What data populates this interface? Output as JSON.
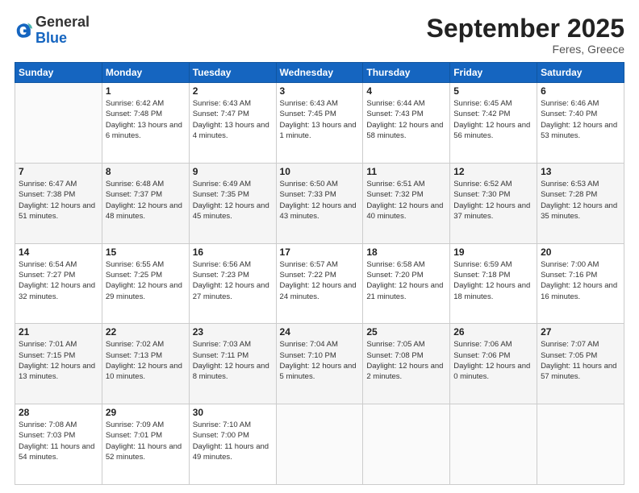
{
  "header": {
    "logo": {
      "general": "General",
      "blue": "Blue"
    },
    "title": "September 2025",
    "location": "Feres, Greece"
  },
  "weekdays": [
    "Sunday",
    "Monday",
    "Tuesday",
    "Wednesday",
    "Thursday",
    "Friday",
    "Saturday"
  ],
  "weeks": [
    [
      {
        "day": "",
        "sunrise": "",
        "sunset": "",
        "daylight": ""
      },
      {
        "day": "1",
        "sunrise": "Sunrise: 6:42 AM",
        "sunset": "Sunset: 7:48 PM",
        "daylight": "Daylight: 13 hours and 6 minutes."
      },
      {
        "day": "2",
        "sunrise": "Sunrise: 6:43 AM",
        "sunset": "Sunset: 7:47 PM",
        "daylight": "Daylight: 13 hours and 4 minutes."
      },
      {
        "day": "3",
        "sunrise": "Sunrise: 6:43 AM",
        "sunset": "Sunset: 7:45 PM",
        "daylight": "Daylight: 13 hours and 1 minute."
      },
      {
        "day": "4",
        "sunrise": "Sunrise: 6:44 AM",
        "sunset": "Sunset: 7:43 PM",
        "daylight": "Daylight: 12 hours and 58 minutes."
      },
      {
        "day": "5",
        "sunrise": "Sunrise: 6:45 AM",
        "sunset": "Sunset: 7:42 PM",
        "daylight": "Daylight: 12 hours and 56 minutes."
      },
      {
        "day": "6",
        "sunrise": "Sunrise: 6:46 AM",
        "sunset": "Sunset: 7:40 PM",
        "daylight": "Daylight: 12 hours and 53 minutes."
      }
    ],
    [
      {
        "day": "7",
        "sunrise": "Sunrise: 6:47 AM",
        "sunset": "Sunset: 7:38 PM",
        "daylight": "Daylight: 12 hours and 51 minutes."
      },
      {
        "day": "8",
        "sunrise": "Sunrise: 6:48 AM",
        "sunset": "Sunset: 7:37 PM",
        "daylight": "Daylight: 12 hours and 48 minutes."
      },
      {
        "day": "9",
        "sunrise": "Sunrise: 6:49 AM",
        "sunset": "Sunset: 7:35 PM",
        "daylight": "Daylight: 12 hours and 45 minutes."
      },
      {
        "day": "10",
        "sunrise": "Sunrise: 6:50 AM",
        "sunset": "Sunset: 7:33 PM",
        "daylight": "Daylight: 12 hours and 43 minutes."
      },
      {
        "day": "11",
        "sunrise": "Sunrise: 6:51 AM",
        "sunset": "Sunset: 7:32 PM",
        "daylight": "Daylight: 12 hours and 40 minutes."
      },
      {
        "day": "12",
        "sunrise": "Sunrise: 6:52 AM",
        "sunset": "Sunset: 7:30 PM",
        "daylight": "Daylight: 12 hours and 37 minutes."
      },
      {
        "day": "13",
        "sunrise": "Sunrise: 6:53 AM",
        "sunset": "Sunset: 7:28 PM",
        "daylight": "Daylight: 12 hours and 35 minutes."
      }
    ],
    [
      {
        "day": "14",
        "sunrise": "Sunrise: 6:54 AM",
        "sunset": "Sunset: 7:27 PM",
        "daylight": "Daylight: 12 hours and 32 minutes."
      },
      {
        "day": "15",
        "sunrise": "Sunrise: 6:55 AM",
        "sunset": "Sunset: 7:25 PM",
        "daylight": "Daylight: 12 hours and 29 minutes."
      },
      {
        "day": "16",
        "sunrise": "Sunrise: 6:56 AM",
        "sunset": "Sunset: 7:23 PM",
        "daylight": "Daylight: 12 hours and 27 minutes."
      },
      {
        "day": "17",
        "sunrise": "Sunrise: 6:57 AM",
        "sunset": "Sunset: 7:22 PM",
        "daylight": "Daylight: 12 hours and 24 minutes."
      },
      {
        "day": "18",
        "sunrise": "Sunrise: 6:58 AM",
        "sunset": "Sunset: 7:20 PM",
        "daylight": "Daylight: 12 hours and 21 minutes."
      },
      {
        "day": "19",
        "sunrise": "Sunrise: 6:59 AM",
        "sunset": "Sunset: 7:18 PM",
        "daylight": "Daylight: 12 hours and 18 minutes."
      },
      {
        "day": "20",
        "sunrise": "Sunrise: 7:00 AM",
        "sunset": "Sunset: 7:16 PM",
        "daylight": "Daylight: 12 hours and 16 minutes."
      }
    ],
    [
      {
        "day": "21",
        "sunrise": "Sunrise: 7:01 AM",
        "sunset": "Sunset: 7:15 PM",
        "daylight": "Daylight: 12 hours and 13 minutes."
      },
      {
        "day": "22",
        "sunrise": "Sunrise: 7:02 AM",
        "sunset": "Sunset: 7:13 PM",
        "daylight": "Daylight: 12 hours and 10 minutes."
      },
      {
        "day": "23",
        "sunrise": "Sunrise: 7:03 AM",
        "sunset": "Sunset: 7:11 PM",
        "daylight": "Daylight: 12 hours and 8 minutes."
      },
      {
        "day": "24",
        "sunrise": "Sunrise: 7:04 AM",
        "sunset": "Sunset: 7:10 PM",
        "daylight": "Daylight: 12 hours and 5 minutes."
      },
      {
        "day": "25",
        "sunrise": "Sunrise: 7:05 AM",
        "sunset": "Sunset: 7:08 PM",
        "daylight": "Daylight: 12 hours and 2 minutes."
      },
      {
        "day": "26",
        "sunrise": "Sunrise: 7:06 AM",
        "sunset": "Sunset: 7:06 PM",
        "daylight": "Daylight: 12 hours and 0 minutes."
      },
      {
        "day": "27",
        "sunrise": "Sunrise: 7:07 AM",
        "sunset": "Sunset: 7:05 PM",
        "daylight": "Daylight: 11 hours and 57 minutes."
      }
    ],
    [
      {
        "day": "28",
        "sunrise": "Sunrise: 7:08 AM",
        "sunset": "Sunset: 7:03 PM",
        "daylight": "Daylight: 11 hours and 54 minutes."
      },
      {
        "day": "29",
        "sunrise": "Sunrise: 7:09 AM",
        "sunset": "Sunset: 7:01 PM",
        "daylight": "Daylight: 11 hours and 52 minutes."
      },
      {
        "day": "30",
        "sunrise": "Sunrise: 7:10 AM",
        "sunset": "Sunset: 7:00 PM",
        "daylight": "Daylight: 11 hours and 49 minutes."
      },
      {
        "day": "",
        "sunrise": "",
        "sunset": "",
        "daylight": ""
      },
      {
        "day": "",
        "sunrise": "",
        "sunset": "",
        "daylight": ""
      },
      {
        "day": "",
        "sunrise": "",
        "sunset": "",
        "daylight": ""
      },
      {
        "day": "",
        "sunrise": "",
        "sunset": "",
        "daylight": ""
      }
    ]
  ]
}
